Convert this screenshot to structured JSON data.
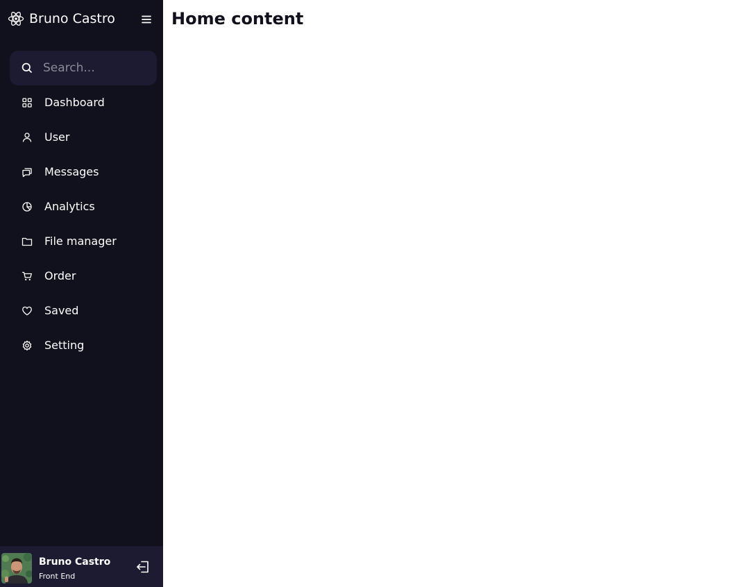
{
  "sidebar": {
    "logo": {
      "name": "Bruno Castro",
      "icon": "react-atom-icon"
    },
    "menu_icon": "hamburger-menu-icon",
    "search": {
      "placeholder": "Search...",
      "value": "",
      "icon": "search-icon"
    },
    "items": [
      {
        "label": "Dashboard",
        "icon": "grid-icon"
      },
      {
        "label": "User",
        "icon": "user-icon"
      },
      {
        "label": "Messages",
        "icon": "chat-icon"
      },
      {
        "label": "Analytics",
        "icon": "pie-chart-icon"
      },
      {
        "label": "File manager",
        "icon": "folder-icon"
      },
      {
        "label": "Order",
        "icon": "cart-icon"
      },
      {
        "label": "Saved",
        "icon": "heart-icon"
      },
      {
        "label": "Setting",
        "icon": "gear-icon"
      }
    ],
    "profile": {
      "name": "Bruno Castro",
      "job": "Front End",
      "logout_icon": "logout-icon"
    }
  },
  "main": {
    "title": "Home content"
  },
  "colors": {
    "sidebar_bg": "#11101d",
    "panel_bg": "#1d1b31",
    "text": "#ffffff",
    "heading": "#11101d"
  }
}
